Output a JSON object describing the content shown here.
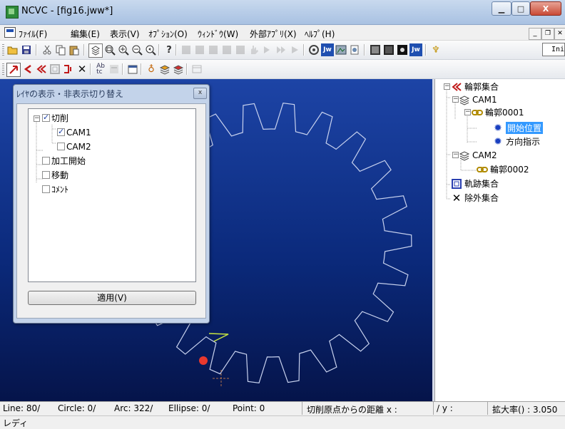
{
  "window": {
    "title": "NCVC - [fig16.jww*]",
    "minimize": "▁",
    "maximize": "□",
    "close": "X"
  },
  "menu": {
    "items": [
      {
        "label": "ﾌｧｲﾙ(F)"
      },
      {
        "label": "編集(E)"
      },
      {
        "label": "表示(V)"
      },
      {
        "label": "ｵﾌﾟｼｮﾝ(O)"
      },
      {
        "label": "ｳｨﾝﾄﾞｳ(W)"
      },
      {
        "label": "外部ｱﾌﾟﾘ(X)"
      },
      {
        "label": "ﾍﾙﾌﾟ(H)"
      }
    ],
    "mdi_min": "_",
    "mdi_restore": "❐",
    "mdi_close": "✕"
  },
  "toolbar": {
    "init_label": "Init.mnc"
  },
  "layer_dialog": {
    "title": "ﾚｲﾔの表示・非表示切り替え",
    "close": "x",
    "items": [
      {
        "label": "切削",
        "checked": true
      },
      {
        "label": "CAM1",
        "checked": true
      },
      {
        "label": "CAM2",
        "checked": false
      },
      {
        "label": "加工開始",
        "checked": false
      },
      {
        "label": "移動",
        "checked": false
      },
      {
        "label": "ｺﾒﾝﾄ",
        "checked": false
      }
    ],
    "apply_label": "適用(V)"
  },
  "tree": {
    "root": "輪郭集合",
    "cam1": "CAM1",
    "outline1": "輪郭0001",
    "start_pos": "開始位置",
    "direction": "方向指示",
    "cam2": "CAM2",
    "outline2": "輪郭0002",
    "trajectory": "軌跡集合",
    "exclusion": "除外集合"
  },
  "status": {
    "line": "Line:   80/",
    "circle": "Circle:   0/",
    "arc": "Arc:  322/",
    "ellipse": "Ellipse:    0/",
    "point": "Point:    0",
    "distance_label": "切削原点からの距離 x :",
    "y_label": "/ y :",
    "zoom_label": "拡大率() : 3.050",
    "ready": "レディ"
  },
  "colors": {
    "canvas_top": "#1d44a6",
    "canvas_bottom": "#05144a",
    "gear_stroke": "#c8d2ee",
    "marker": "#e8382e",
    "direction_arrow": "#c8e640",
    "selected": "#3399ff"
  }
}
